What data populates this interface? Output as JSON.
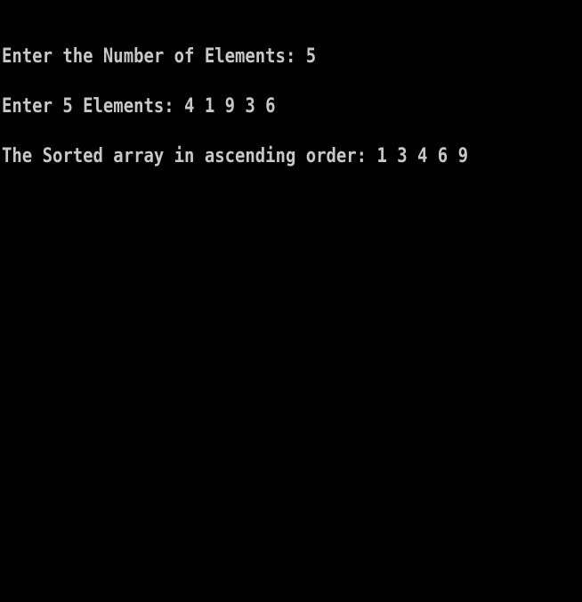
{
  "console": {
    "lines": [
      "Enter the Number of Elements: 5",
      "Enter 5 Elements: 4 1 9 3 6",
      "The Sorted array in ascending order: 1 3 4 6 9"
    ]
  }
}
